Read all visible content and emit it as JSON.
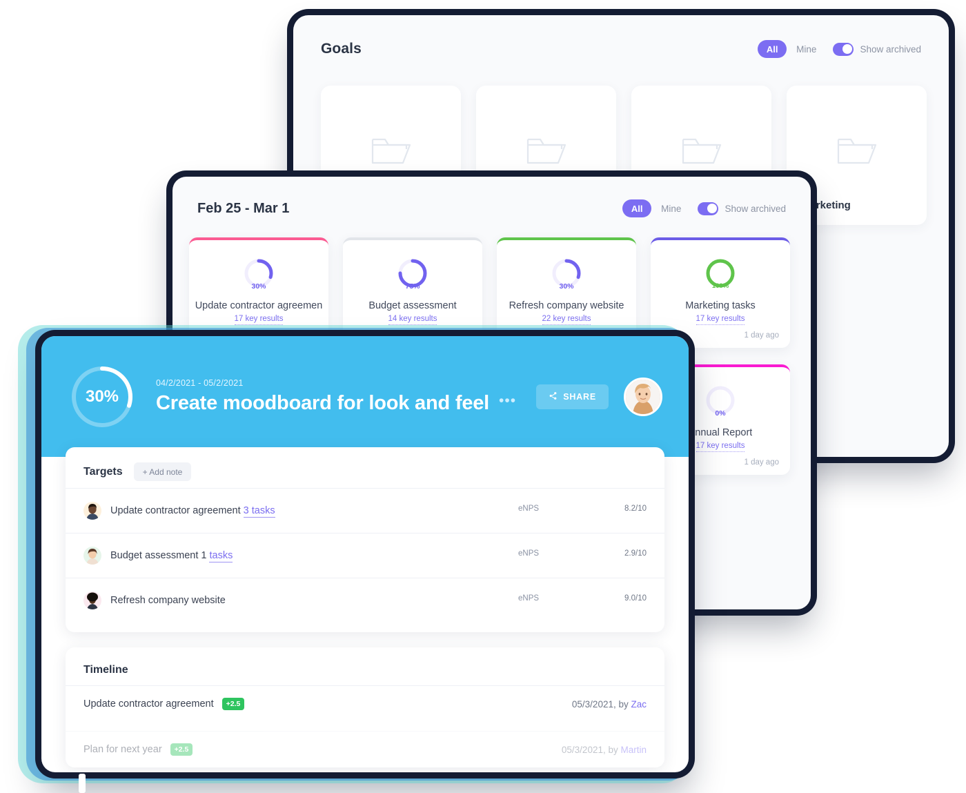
{
  "colors": {
    "accent_purple": "#7c6df2",
    "hero_blue": "#42bdee",
    "green": "#5fc44b",
    "pink": "#fb5b92",
    "magenta": "#f91ad1",
    "grey": "#d8dce3",
    "chip_green": "#2ec45f"
  },
  "goals_window": {
    "title": "Goals",
    "filter": {
      "all_label": "All",
      "mine_label": "Mine",
      "archived_label": "Show archived",
      "archived_on": true
    },
    "folders": [
      {
        "label": "",
        "icon": "folder-icon"
      },
      {
        "label": "",
        "icon": "folder-icon"
      },
      {
        "label": "",
        "icon": "folder-icon"
      },
      {
        "label": "Marketing",
        "icon": "folder-icon"
      }
    ]
  },
  "week_window": {
    "title": "Feb 25 - Mar 1",
    "filter": {
      "all_label": "All",
      "mine_label": "Mine",
      "archived_label": "Show archived",
      "archived_on": true
    },
    "cards": [
      {
        "name": "Update contractor agreemen",
        "percent": 30,
        "percent_label": "30%",
        "key_results": "17 key results",
        "accent": "#fb5b92",
        "ring_color": "#7162ef",
        "ago": ""
      },
      {
        "name": "Budget assessment",
        "percent": 75,
        "percent_label": "75%",
        "key_results": "14 key results",
        "accent": "#e2e5ea",
        "ring_color": "#7162ef",
        "ago": ""
      },
      {
        "name": "Refresh company website",
        "percent": 30,
        "percent_label": "30%",
        "key_results": "22 key results",
        "accent": "#5fc44b",
        "ring_color": "#7162ef",
        "ago": ""
      },
      {
        "name": "Marketing tasks",
        "percent": 100,
        "percent_label": "100%",
        "key_results": "17 key results",
        "accent": "#6c5ce7",
        "ring_color": "#5fc44b",
        "ago": "1 day ago"
      },
      {
        "name": "Annual Report",
        "percent": 0,
        "percent_label": "0%",
        "key_results": "17 key results",
        "accent": "#f91ad1",
        "ring_color": "#7162ef",
        "ago": "1 day ago"
      }
    ]
  },
  "detail_window": {
    "hero": {
      "percent": 30,
      "percent_label": "30%",
      "date_range": "04/2/2021 - 05/2/2021",
      "title": "Create moodboard for look and feel",
      "menu_dots": "•••",
      "share_label": "SHARE"
    },
    "targets": {
      "title": "Targets",
      "add_note_label": "+ Add note",
      "rows": [
        {
          "name": "Update contractor agreement ",
          "tasks_link": "3 tasks",
          "metric_label": "eNPS",
          "value_label": "8.2/10",
          "value": 8.2,
          "max": 10,
          "avatar_skin": "#8d5a3b",
          "avatar_bg": "#fdf0dc"
        },
        {
          "name": "Budget assessment 1 ",
          "tasks_link": "tasks",
          "metric_label": "eNPS",
          "value_label": "2.9/10",
          "value": 2.9,
          "max": 10,
          "avatar_skin": "#e6b191",
          "avatar_bg": "#e6f5ea"
        },
        {
          "name": "Refresh company website",
          "tasks_link": "",
          "metric_label": "eNPS",
          "value_label": "9.0/10",
          "value": 9.0,
          "max": 10,
          "avatar_skin": "#6b4430",
          "avatar_bg": "#fbe9ef"
        }
      ]
    },
    "timeline": {
      "title": "Timeline",
      "rows": [
        {
          "name": "Update contractor agreement",
          "chip": "+2.5",
          "date": "05/3/2021, by ",
          "author": "Zac",
          "faded": false
        },
        {
          "name": "Plan for next year",
          "chip": "+2.5",
          "date": "05/3/2021, by ",
          "author": "Martin",
          "faded": true
        }
      ]
    }
  }
}
